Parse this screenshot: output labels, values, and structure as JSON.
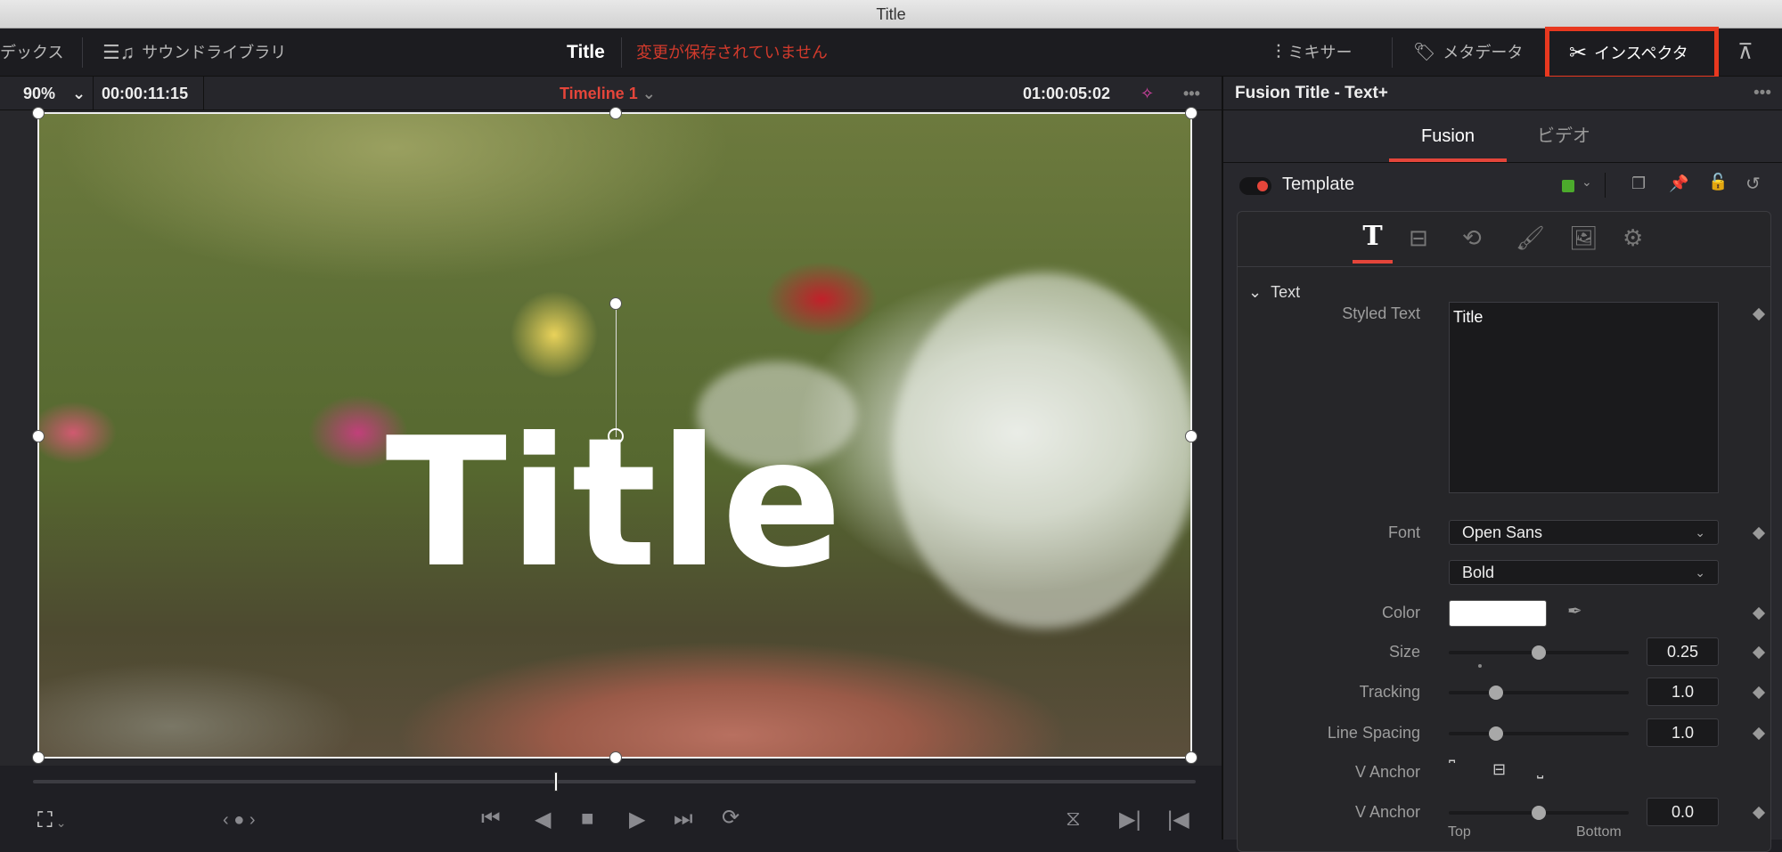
{
  "window": {
    "title": "Title"
  },
  "topbar": {
    "left_cut": "デックス",
    "sound_library": "サウンドライブラリ",
    "project_title": "Title",
    "unsaved": "変更が保存されていません",
    "mixer": "ミキサー",
    "metadata": "メタデータ",
    "inspector": "インスペクタ"
  },
  "viewer": {
    "zoom": "90%",
    "timecode_left": "00:00:11:15",
    "timeline": "Timeline 1",
    "timecode_right": "01:00:05:02",
    "overlay_text": "Title",
    "scrubber_position": 0.45
  },
  "inspector": {
    "header": "Fusion Title - Text+",
    "tabs": [
      {
        "label": "Fusion",
        "active": true
      },
      {
        "label": "ビデオ",
        "active": false
      }
    ],
    "template_label": "Template",
    "template_color": "#4caa2c",
    "section": "Text",
    "styled_text_label": "Styled Text",
    "styled_text_value": "Title",
    "font_label": "Font",
    "font_value": "Open Sans",
    "style_value": "Bold",
    "color_label": "Color",
    "color_value": "#ffffff",
    "size_label": "Size",
    "size_value": "0.25",
    "size_fraction": 0.5,
    "tracking_label": "Tracking",
    "tracking_value": "1.0",
    "tracking_fraction": 0.26,
    "line_spacing_label": "Line Spacing",
    "line_spacing_value": "1.0",
    "line_spacing_fraction": 0.26,
    "v_anchor_label": "V Anchor",
    "v_anchor2_label": "V Anchor",
    "v_anchor_value": "0.0",
    "v_anchor_fraction": 0.5,
    "top_label": "Top",
    "bottom_label": "Bottom"
  },
  "colors": {
    "accent_red": "#e4453a",
    "highlight_box": "#e8381f"
  }
}
